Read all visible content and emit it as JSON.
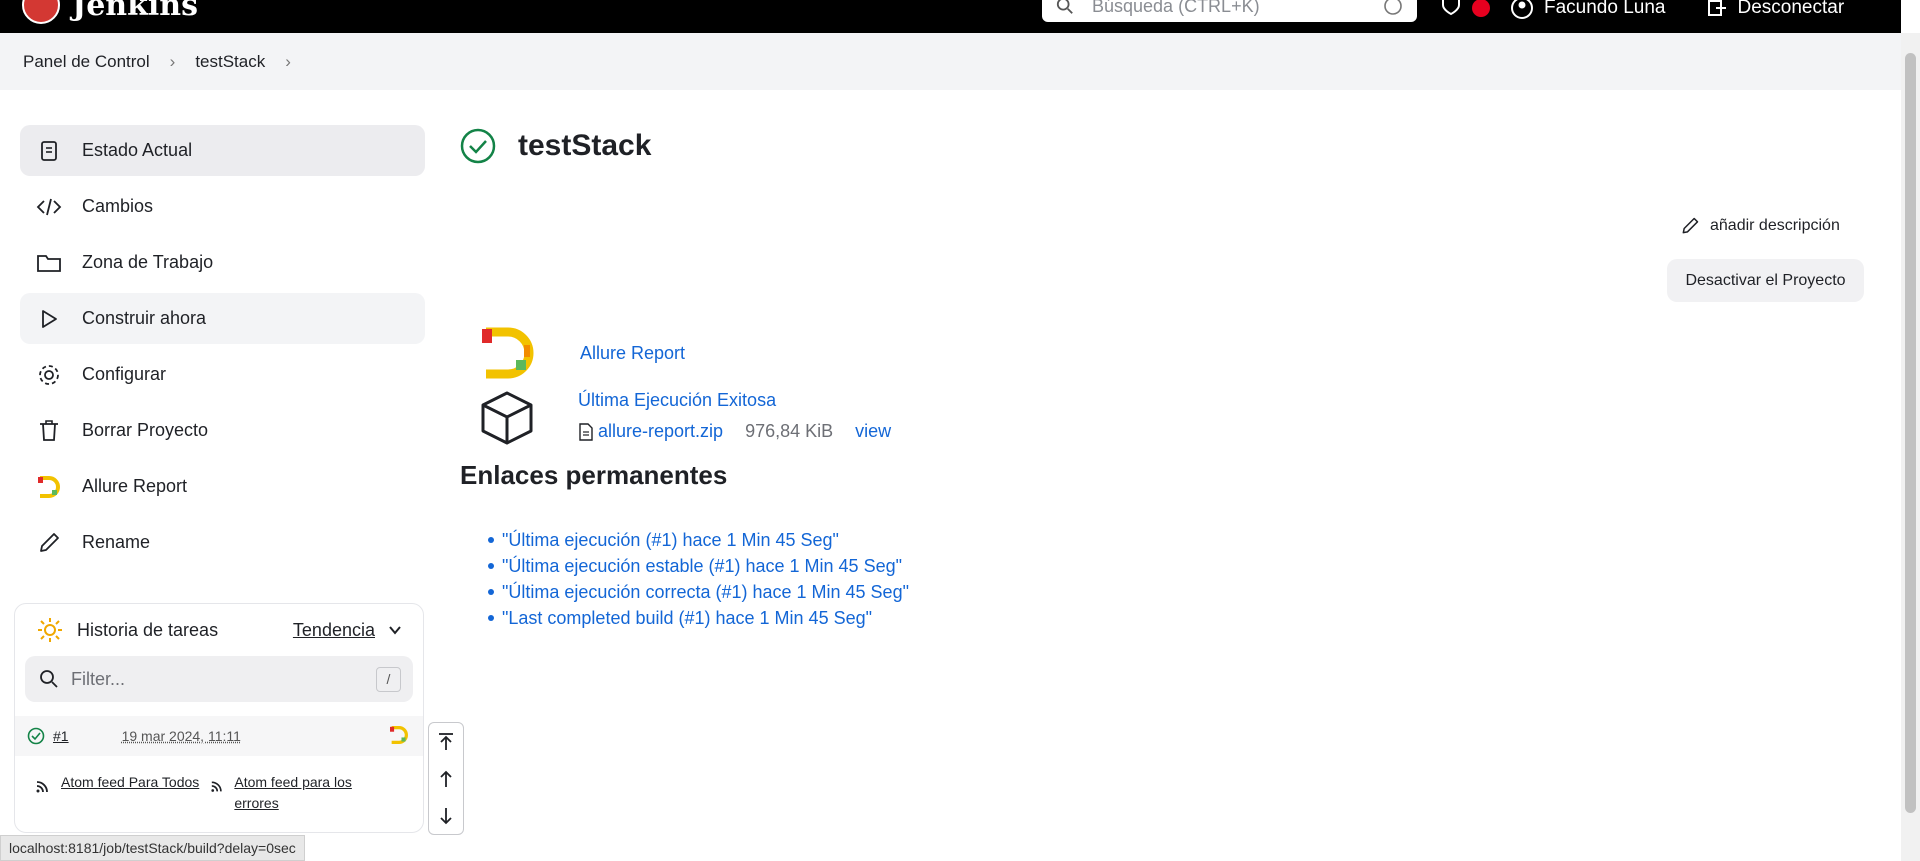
{
  "header": {
    "app_name": "Jenkins",
    "search_placeholder": "Búsqueda (CTRL+K)",
    "user_name": "Facundo Luna",
    "logout": "Desconectar"
  },
  "breadcrumb": [
    "Panel de Control",
    "testStack"
  ],
  "sidebar": {
    "items": [
      {
        "label": "Estado Actual",
        "icon": "status-icon"
      },
      {
        "label": "Cambios",
        "icon": "code-icon"
      },
      {
        "label": "Zona de Trabajo",
        "icon": "folder-icon"
      },
      {
        "label": "Construir ahora",
        "icon": "play-icon"
      },
      {
        "label": "Configurar",
        "icon": "gear-icon"
      },
      {
        "label": "Borrar Proyecto",
        "icon": "trash-icon"
      },
      {
        "label": "Allure Report",
        "icon": "allure-icon"
      },
      {
        "label": "Rename",
        "icon": "pencil-icon"
      }
    ]
  },
  "history": {
    "title": "Historia de tareas",
    "trend": "Tendencia",
    "filter_placeholder": "Filter...",
    "filter_key": "/",
    "builds": [
      {
        "number": "#1",
        "date": "19 mar 2024, 11:11"
      }
    ],
    "feed_all": "Atom feed Para Todos",
    "feed_errors": "Atom feed para los errores"
  },
  "main": {
    "title": "testStack",
    "add_description": "añadir descripción",
    "disable_project": "Desactivar el Proyecto",
    "allure_report": "Allure Report",
    "last_success": "Última Ejecución Exitosa",
    "artifact_name": "allure-report.zip",
    "artifact_size": "976,84 KiB",
    "artifact_view": "view",
    "permalinks_title": "Enlaces permanentes",
    "permalinks": [
      "\"Última ejecución (#1) hace 1 Min 45 Seg\"",
      "\"Última ejecución estable (#1) hace 1 Min 45 Seg\"",
      "\"Última ejecución correcta (#1) hace 1 Min 45 Seg\"",
      "\"Last completed build (#1) hace 1 Min 45 Seg\""
    ]
  },
  "statusbar": "localhost:8181/job/testStack/build?delay=0sec",
  "colors": {
    "accent": "#1366d6",
    "success": "#138347",
    "header": "#000000"
  }
}
